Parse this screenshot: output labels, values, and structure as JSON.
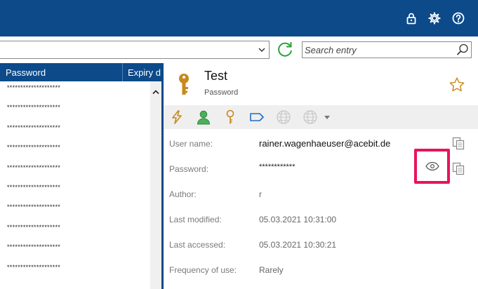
{
  "header": {
    "icons": [
      "lock-icon",
      "gear-icon",
      "help-icon"
    ],
    "bg_color": "#0c4a8a"
  },
  "toolbar": {
    "path_value": "",
    "search_placeholder": "Search entry"
  },
  "list": {
    "columns": [
      "Password",
      "Expiry d"
    ],
    "masked": "********************",
    "row_count": 10
  },
  "detail": {
    "title": "Test",
    "subtitle": "Password",
    "actions": [
      "autotype-icon",
      "user-icon",
      "key-icon",
      "tag-icon",
      "globe-icon",
      "globe-dropdown-icon"
    ],
    "fields": [
      {
        "label": "User name:",
        "value": "rainer.wagenhaeuser@acebit.de"
      },
      {
        "label": "Password:",
        "value": "************"
      },
      {
        "label": "Author:",
        "value": "r"
      },
      {
        "label": "Last modified:",
        "value": "05.03.2021 10:31:00"
      },
      {
        "label": "Last accessed:",
        "value": "05.03.2021 10:30:21"
      },
      {
        "label": "Frequency of use:",
        "value": "Rarely"
      }
    ]
  },
  "colors": {
    "accent": "#0c4a8a",
    "highlight": "#e8145a",
    "key": "#c8891a",
    "user": "#2e9e44",
    "refresh": "#2aa33a"
  }
}
